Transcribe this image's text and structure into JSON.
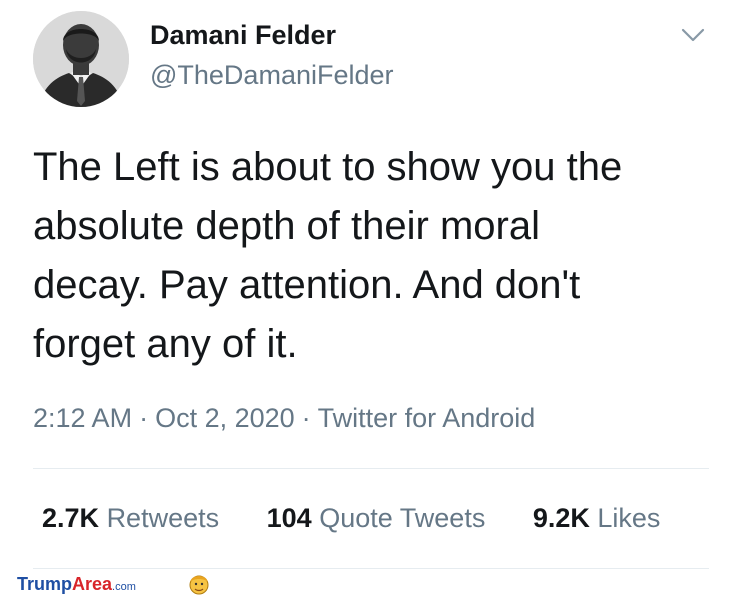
{
  "user": {
    "display_name": "Damani Felder",
    "handle": "@TheDamaniFelder"
  },
  "tweet": {
    "lines": [
      "The Left is about to show you the",
      "absolute depth of their moral",
      "decay. Pay attention. And don't",
      "forget any of it."
    ]
  },
  "meta": {
    "time": "2:12 AM",
    "separator": "·",
    "date": "Oct 2, 2020",
    "source": "Twitter for Android"
  },
  "stats": {
    "retweets": {
      "count": "2.7K",
      "label": "Retweets"
    },
    "quote_tweets": {
      "count": "104",
      "label": "Quote Tweets"
    },
    "likes": {
      "count": "9.2K",
      "label": "Likes"
    }
  },
  "watermark": {
    "brand_part1": "Trump",
    "brand_part2": "Area",
    "brand_suffix": ".com"
  },
  "icons": {
    "menu": "chevron-down-icon",
    "watermark_face": "cartoon-face-icon"
  },
  "colors": {
    "text_primary": "#14171a",
    "text_secondary": "#657786",
    "divider": "#e6ecf0",
    "watermark_blue": "#1f4fa3",
    "watermark_red": "#d8252a"
  }
}
